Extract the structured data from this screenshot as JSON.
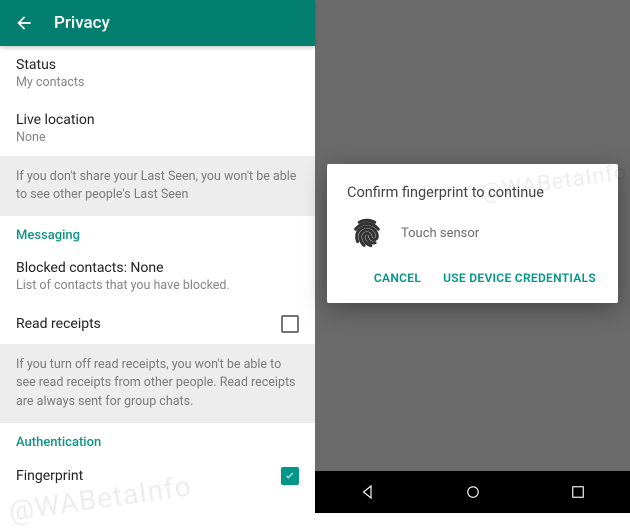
{
  "left": {
    "header": {
      "title": "Privacy"
    },
    "status": {
      "title": "Status",
      "subtitle": "My contacts"
    },
    "live_location": {
      "title": "Live location",
      "subtitle": "None"
    },
    "info_lastseen": "If you don't share your Last Seen, you won't be able to see other people's Last Seen",
    "section_messaging": "Messaging",
    "blocked": {
      "title": "Blocked contacts: None",
      "subtitle": "List of contacts that you have blocked."
    },
    "read_receipts": {
      "title": "Read receipts",
      "checked": false
    },
    "info_readreceipts": "If you turn off read receipts, you won't be able to see read receipts from other people. Read receipts are always sent for group chats.",
    "section_auth": "Authentication",
    "fingerprint": {
      "title": "Fingerprint",
      "checked": true
    },
    "watermark": "@WABetaInfo"
  },
  "right": {
    "dialog": {
      "title": "Confirm fingerprint to continue",
      "touch_label": "Touch sensor",
      "cancel": "CANCEL",
      "credentials": "USE DEVICE CREDENTIALS"
    },
    "watermark": "@WABetaInfo"
  }
}
